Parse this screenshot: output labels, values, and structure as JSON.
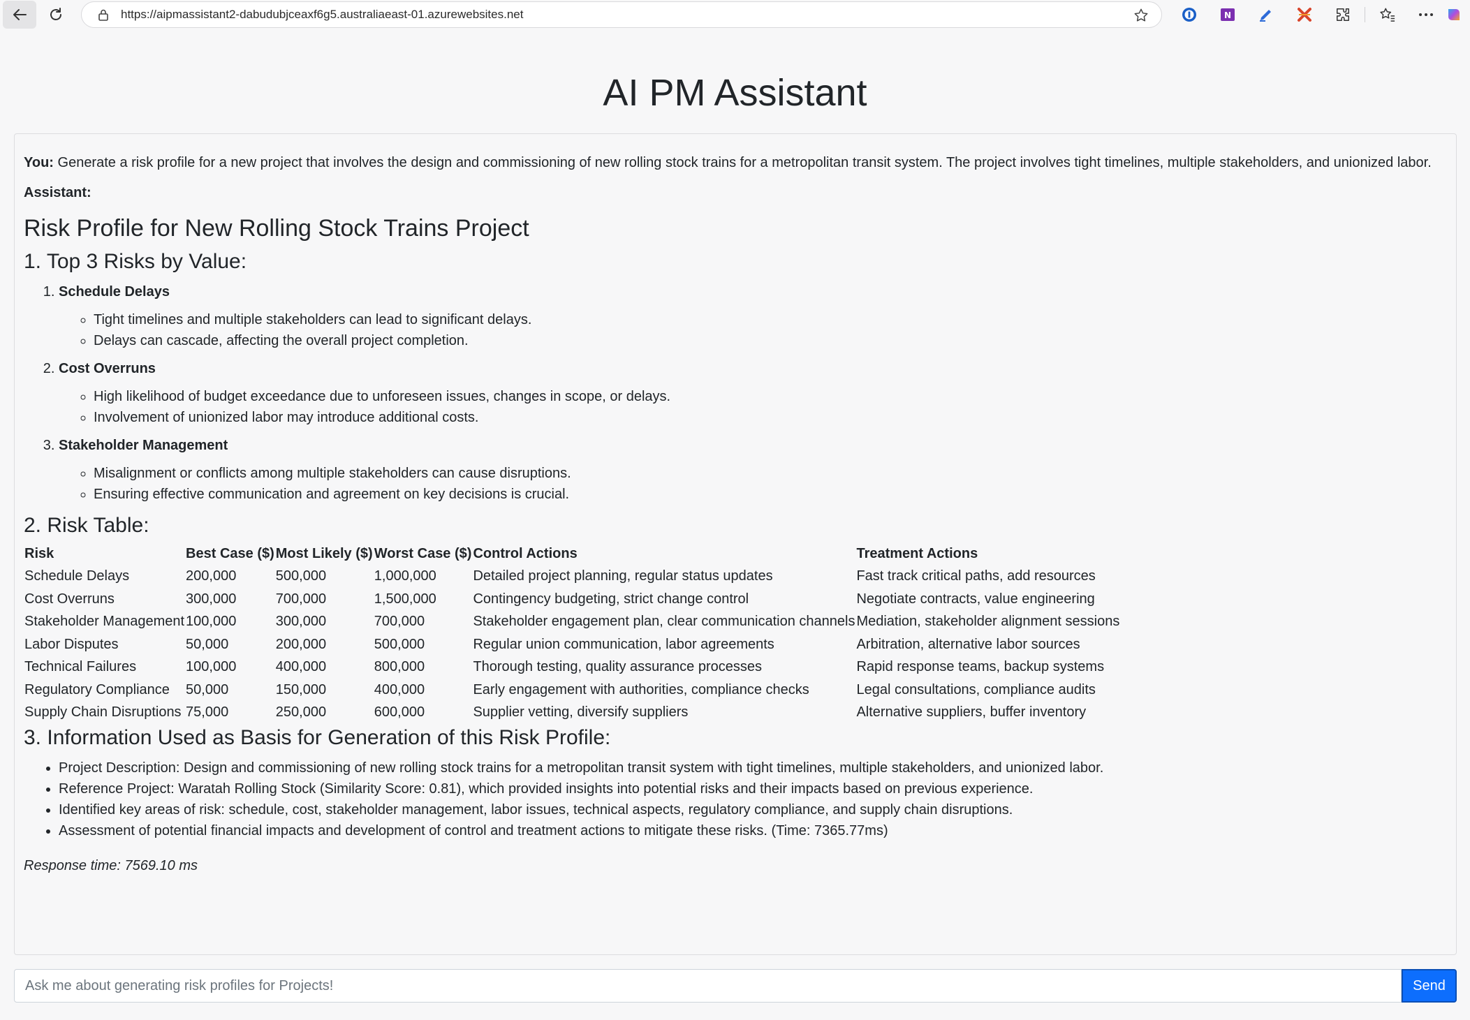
{
  "browser": {
    "url": "https://aipmassistant2-dabudubjceaxf6g5.australiaeast-01.azurewebsites.net",
    "extensions": [
      "password-manager-icon",
      "onenote-icon",
      "pen-extension-icon",
      "x-extension-icon",
      "extensions-puzzle-icon"
    ]
  },
  "page": {
    "title": "AI PM Assistant"
  },
  "chat": {
    "user_label": "You:",
    "user_message": " Generate a risk profile for a new project that involves the design and commissioning of new rolling stock trains for a metropolitan transit system. The project involves tight timelines, multiple stakeholders, and unionized labor.",
    "assistant_label": "Assistant:",
    "response": {
      "title": "Risk Profile for New Rolling Stock Trains Project",
      "section1_title": "1. Top 3 Risks by Value:",
      "top_risks": [
        {
          "name": "Schedule Delays",
          "points": [
            "Tight timelines and multiple stakeholders can lead to significant delays.",
            "Delays can cascade, affecting the overall project completion."
          ]
        },
        {
          "name": "Cost Overruns",
          "points": [
            "High likelihood of budget exceedance due to unforeseen issues, changes in scope, or delays.",
            "Involvement of unionized labor may introduce additional costs."
          ]
        },
        {
          "name": "Stakeholder Management",
          "points": [
            "Misalignment or conflicts among multiple stakeholders can cause disruptions.",
            "Ensuring effective communication and agreement on key decisions is crucial."
          ]
        }
      ],
      "section2_title": "2. Risk Table:",
      "risk_table": {
        "headers": [
          "Risk",
          "Best Case ($)",
          "Most Likely ($)",
          "Worst Case ($)",
          "Control Actions",
          "Treatment Actions"
        ],
        "rows": [
          [
            "Schedule Delays",
            "200,000",
            "500,000",
            "1,000,000",
            "Detailed project planning, regular status updates",
            "Fast track critical paths, add resources"
          ],
          [
            "Cost Overruns",
            "300,000",
            "700,000",
            "1,500,000",
            "Contingency budgeting, strict change control",
            "Negotiate contracts, value engineering"
          ],
          [
            "Stakeholder Management",
            "100,000",
            "300,000",
            "700,000",
            "Stakeholder engagement plan, clear communication channels",
            "Mediation, stakeholder alignment sessions"
          ],
          [
            "Labor Disputes",
            "50,000",
            "200,000",
            "500,000",
            "Regular union communication, labor agreements",
            "Arbitration, alternative labor sources"
          ],
          [
            "Technical Failures",
            "100,000",
            "400,000",
            "800,000",
            "Thorough testing, quality assurance processes",
            "Rapid response teams, backup systems"
          ],
          [
            "Regulatory Compliance",
            "50,000",
            "150,000",
            "400,000",
            "Early engagement with authorities, compliance checks",
            "Legal consultations, compliance audits"
          ],
          [
            "Supply Chain Disruptions",
            "75,000",
            "250,000",
            "600,000",
            "Supplier vetting, diversify suppliers",
            "Alternative suppliers, buffer inventory"
          ]
        ]
      },
      "section3_title": "3. Information Used as Basis for Generation of this Risk Profile:",
      "basis": [
        "Project Description: Design and commissioning of new rolling stock trains for a metropolitan transit system with tight timelines, multiple stakeholders, and unionized labor.",
        "Reference Project: Waratah Rolling Stock (Similarity Score: 0.81), which provided insights into potential risks and their impacts based on previous experience.",
        "Identified key areas of risk: schedule, cost, stakeholder management, labor issues, technical aspects, regulatory compliance, and supply chain disruptions.",
        "Assessment of potential financial impacts and development of control and treatment actions to mitigate these risks. (Time: 7365.77ms)"
      ],
      "response_time": "Response time: 7569.10 ms"
    }
  },
  "composer": {
    "placeholder": "Ask me about generating risk profiles for Projects!",
    "value": "",
    "send_label": "Send"
  },
  "colors": {
    "accent": "#0d6efd",
    "background": "#f7f7f8",
    "text": "#212529"
  }
}
